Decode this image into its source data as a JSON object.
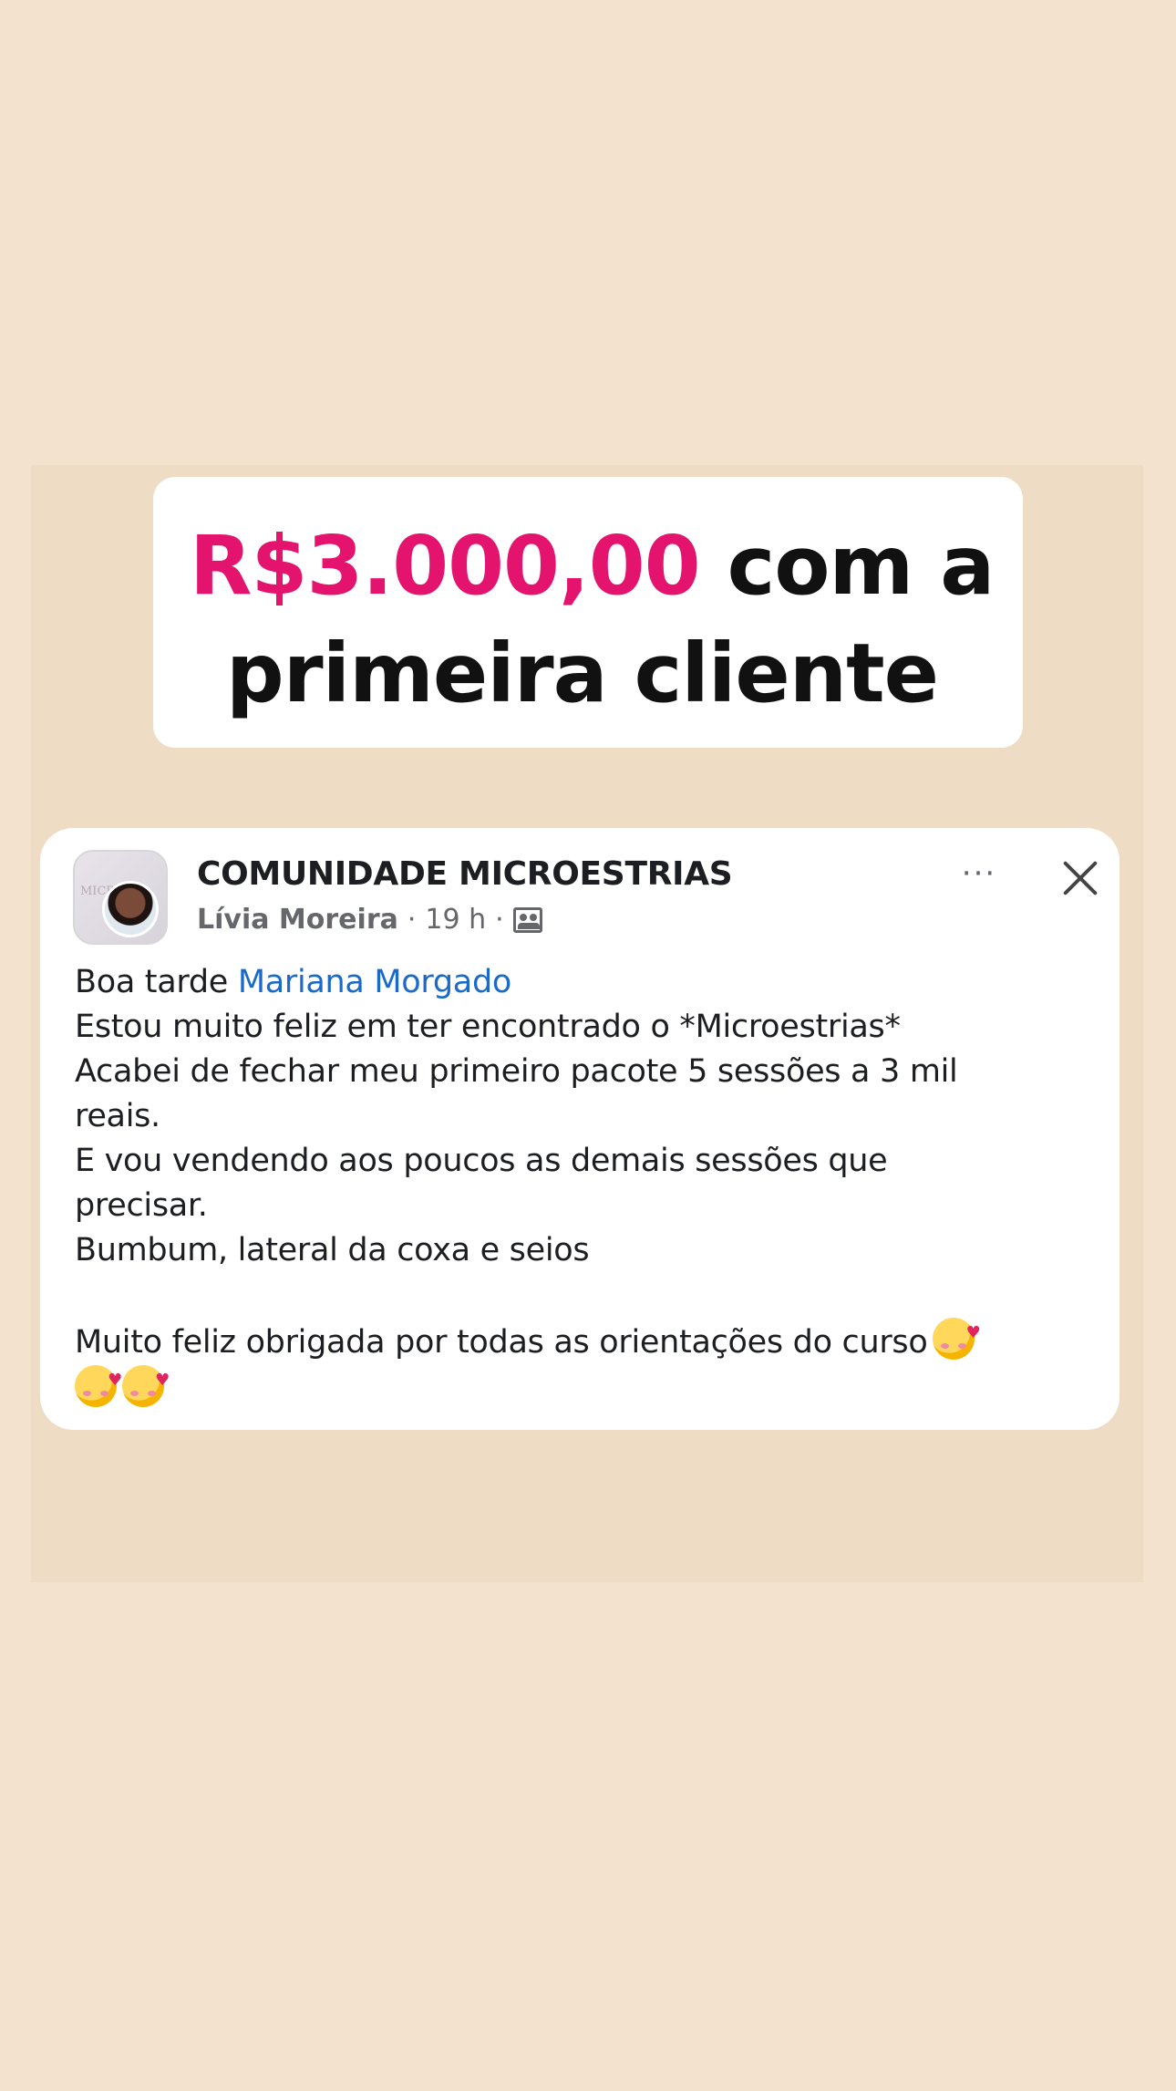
{
  "headline": {
    "price": "R$3.000,00",
    "line1_rest": " com a",
    "line2": "primeira cliente"
  },
  "post": {
    "group_name": "COMUNIDADE MICROESTRIAS",
    "author": "Lívia Moreira",
    "separator": "·",
    "time": "19 h",
    "avatar_text": "MICRO",
    "more_icon": "···",
    "greeting": "Boa tarde ",
    "mention": "Mariana Morgado",
    "lines": [
      "Estou muito feliz em ter encontrado o *Microestrias*",
      "Acabei de fechar meu primeiro pacote 5 sessões a 3 mil",
      "reais.",
      "E vou vendendo aos poucos as demais sessões que",
      "precisar.",
      "Bumbum, lateral da coxa e seios"
    ],
    "closing": "Muito feliz obrigada por todas as orientações do curso"
  },
  "colors": {
    "background": "#f3e2cd",
    "price_accent": "#e3136e",
    "mention_link": "#1b6ac9"
  },
  "icons": [
    "more-icon",
    "close-icon",
    "group-icon",
    "smiling-face-with-hearts-emoji"
  ]
}
